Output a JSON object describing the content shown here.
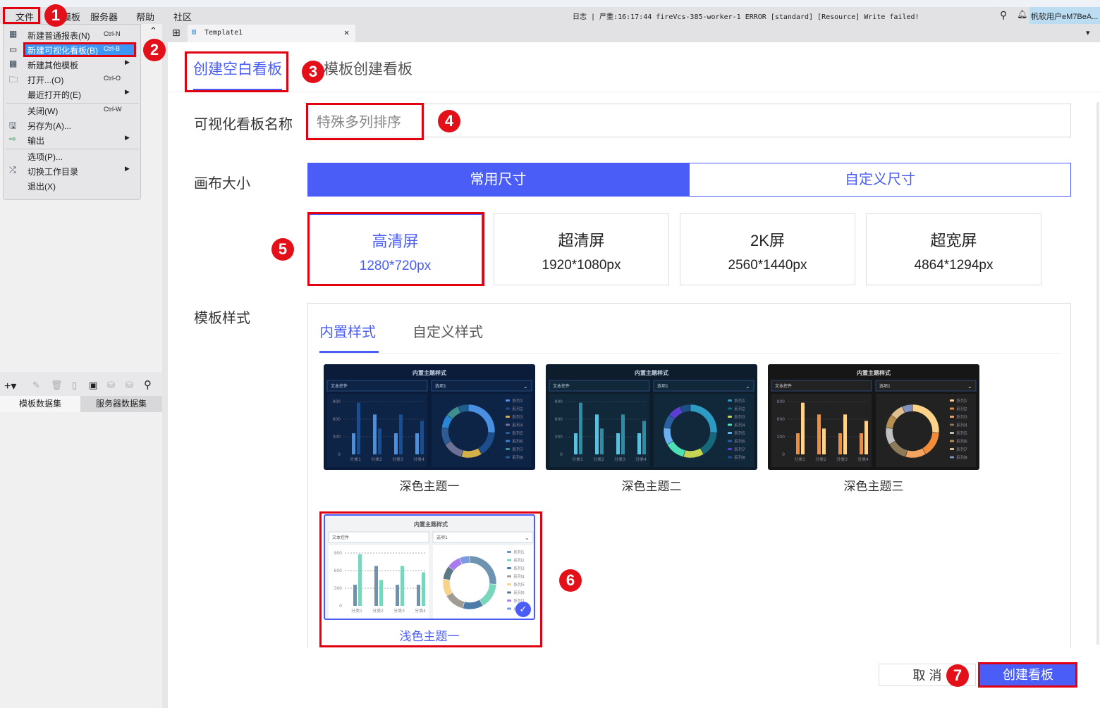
{
  "menubar": {
    "items": [
      "文件",
      "模板",
      "服务器",
      "帮助",
      "社区"
    ],
    "log": "日志 | 严重:16:17:44 fireVcs-385-worker-1 ERROR [standard] [Resource] Write failed!",
    "user": "帆软用户eM7BeA..."
  },
  "file_menu": [
    {
      "label": "新建普通报表(N)",
      "shortcut": "Ctrl-N",
      "icon": "grid-icon"
    },
    {
      "label": "新建可视化看板(B)",
      "shortcut": "Ctrl-B",
      "icon": "dashboard-icon"
    },
    {
      "label": "新建其他模板",
      "icon": "template-icon"
    },
    {
      "label": "打开...(O)",
      "shortcut": "Ctrl-O",
      "icon": "folder-icon"
    },
    {
      "label": "最近打开的(E)"
    },
    {
      "label": "关闭(W)",
      "shortcut": "Ctrl-W"
    },
    {
      "label": "另存为(A)...",
      "icon": "save-icon"
    },
    {
      "label": "输出",
      "icon": "export-icon"
    },
    {
      "label": "选项(P)..."
    },
    {
      "label": "切换工作目录",
      "icon": "shuffle-icon"
    },
    {
      "label": "退出(X)"
    }
  ],
  "doc_tab": "Template1",
  "datasets": {
    "tabs": [
      "模板数据集",
      "服务器数据集"
    ]
  },
  "dialog": {
    "tabs": [
      "创建空白看板",
      "从模板创建看板"
    ],
    "name_label": "可视化看板名称",
    "name_value": "特殊多列排序",
    "canvas_label": "画布大小",
    "canvas_modes": [
      "常用尺寸",
      "自定义尺寸"
    ],
    "sizes": [
      {
        "title": "高清屏",
        "dim": "1280*720px"
      },
      {
        "title": "超清屏",
        "dim": "1920*1080px"
      },
      {
        "title": "2K屏",
        "dim": "2560*1440px"
      },
      {
        "title": "超宽屏",
        "dim": "4864*1294px"
      }
    ],
    "style_label": "模板样式",
    "style_tabs": [
      "内置样式",
      "自定义样式"
    ],
    "thumb_text": {
      "title": "内置主题样式",
      "text_ctrl": "文本控件",
      "option": "选项1",
      "yticks": [
        "0",
        "300",
        "600",
        "900"
      ],
      "cats": [
        "分类1",
        "分类2",
        "分类3",
        "分类4"
      ],
      "series": [
        "系列1",
        "系列2",
        "系列3",
        "系列4",
        "系列5",
        "系列6",
        "系列7",
        "系列8"
      ]
    },
    "themes": [
      {
        "name": "深色主题一",
        "bg": "#0b1c3a",
        "panel": "#0e2447",
        "text": "#c8d4e8",
        "bars": [
          "#4a90e2",
          "#1e4d8c"
        ],
        "donut": [
          "#4a90e2",
          "#1e4d8c",
          "#d4b048",
          "#6d7196",
          "#2f5b94",
          "#2a86d6",
          "#3f8f8e",
          "#1c5f8c"
        ]
      },
      {
        "name": "深色主题二",
        "bg": "#0d1d2c",
        "panel": "#10283a",
        "text": "#c8d4e8",
        "bars": [
          "#5bc0de",
          "#2a8ea6"
        ],
        "donut": [
          "#2d9bc4",
          "#16697a",
          "#c5d452",
          "#4ee0b5",
          "#6bb0f0",
          "#2a5fa0",
          "#5a3fd1",
          "#1b4f8a"
        ]
      },
      {
        "name": "深色主题三",
        "bg": "#161616",
        "panel": "#222222",
        "text": "#ddd",
        "bars": [
          "#f28c38",
          "#ffd28a"
        ],
        "donut": [
          "#ffd28a",
          "#f28c38",
          "#f4a460",
          "#8c7a5a",
          "#c0c0c0",
          "#b79050",
          "#e0c090",
          "#8090c0"
        ]
      },
      {
        "name": "浅色主题一",
        "bg": "#f2f3f5",
        "panel": "#ffffff",
        "text": "#555",
        "bars": [
          "#6d93b0",
          "#79d5bb"
        ],
        "donut": [
          "#6d93b0",
          "#79d5bb",
          "#4d7ca8",
          "#a09c94",
          "#f7d48a",
          "#5c7a86",
          "#a87cf0",
          "#7a9be0"
        ],
        "selected": true
      }
    ],
    "bar_values": [
      [
        360,
        880
      ],
      [
        680,
        440
      ],
      [
        360,
        680
      ],
      [
        360,
        570
      ]
    ],
    "donut_values": [
      25,
      15,
      12,
      12,
      10,
      8,
      8,
      6
    ],
    "cancel": "取 消",
    "create": "创建看板"
  },
  "badges": [
    "1",
    "2",
    "3",
    "4",
    "5",
    "6",
    "7"
  ],
  "colors": {
    "accent": "#4a5ef7",
    "annot": "#e0000f"
  }
}
